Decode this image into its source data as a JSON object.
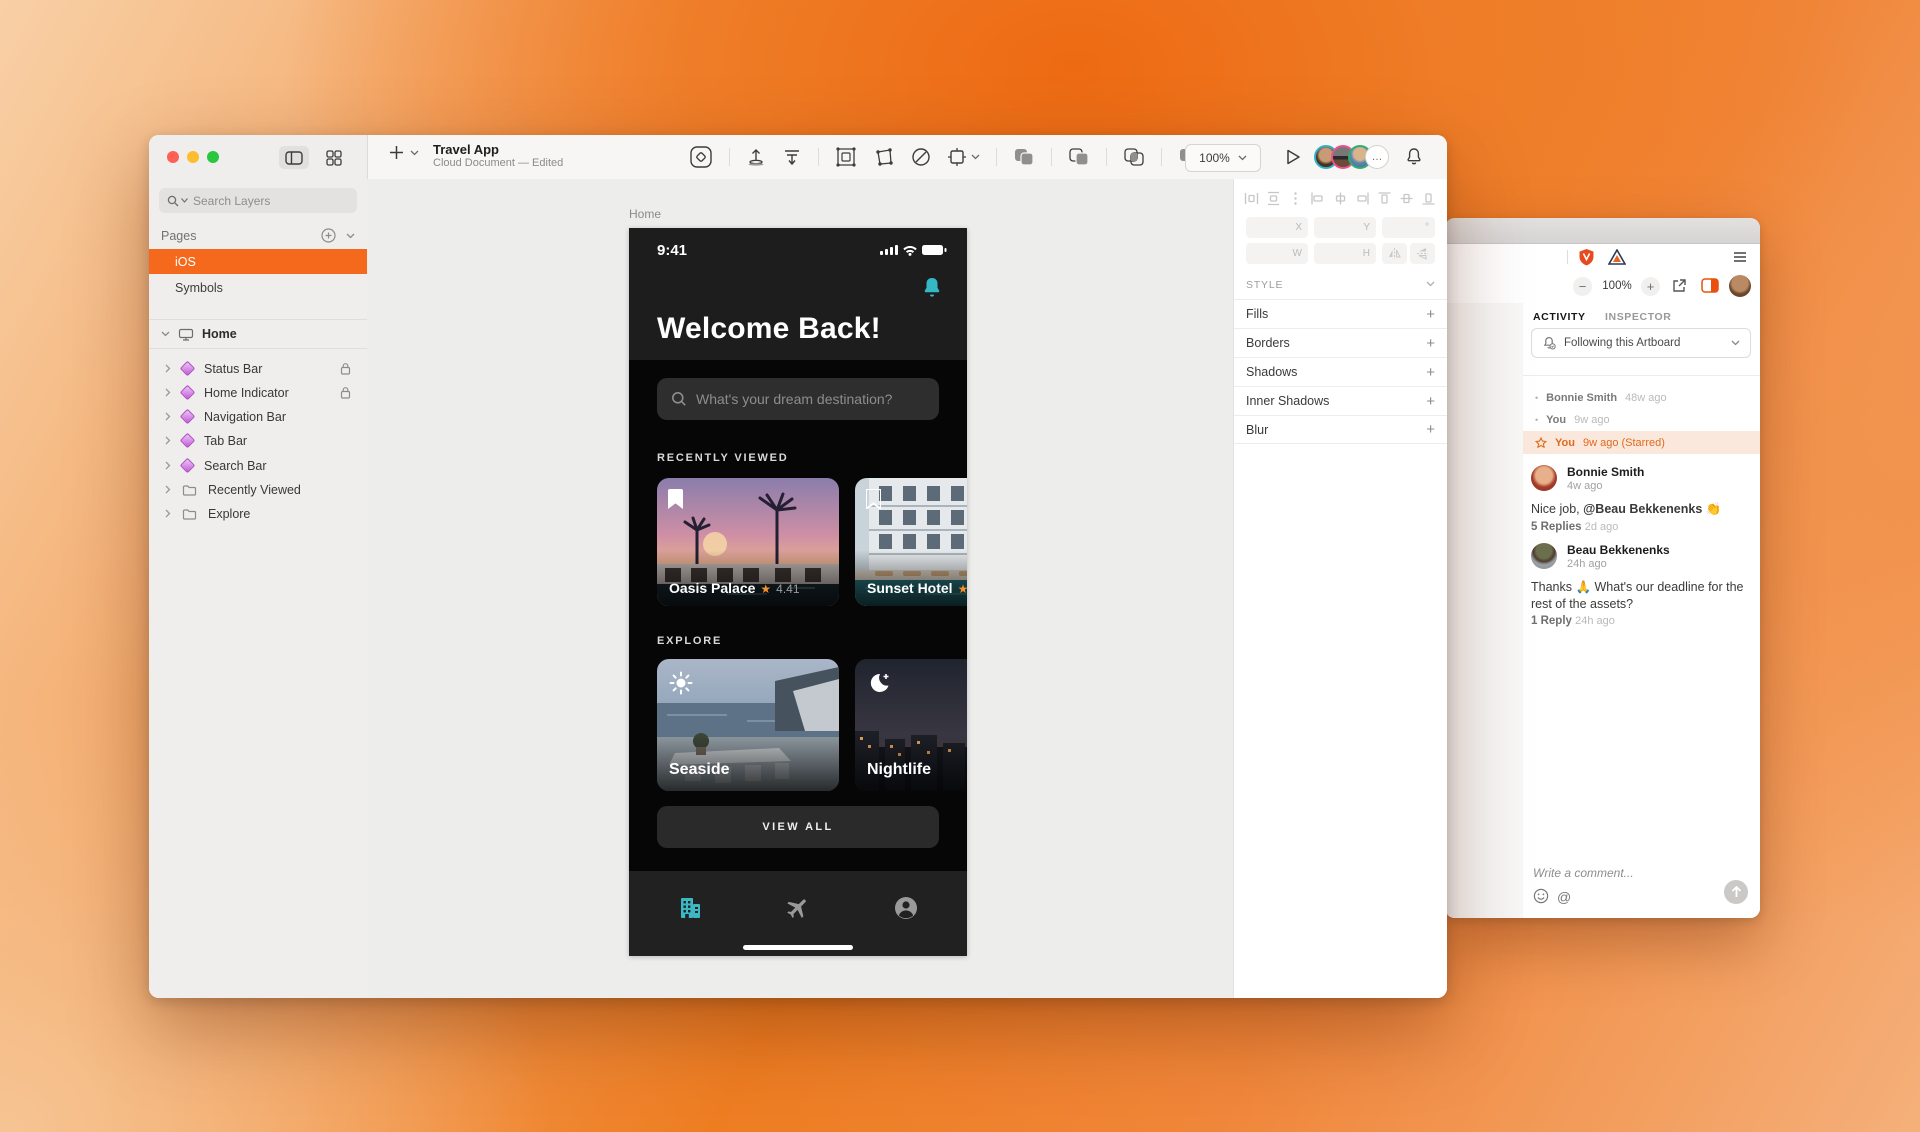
{
  "app": {
    "title": "Travel App",
    "subtitle": "Cloud Document — Edited",
    "zoom": "100%"
  },
  "sidebar": {
    "search_placeholder": "Search Layers",
    "pages_label": "Pages",
    "pages": [
      {
        "label": "iOS"
      },
      {
        "label": "Symbols"
      }
    ],
    "group_label": "Home",
    "layers": [
      {
        "label": "Status Bar"
      },
      {
        "label": "Home Indicator"
      },
      {
        "label": "Navigation Bar"
      },
      {
        "label": "Tab Bar"
      },
      {
        "label": "Search Bar"
      },
      {
        "label": "Recently Viewed"
      },
      {
        "label": "Explore"
      }
    ]
  },
  "canvas": {
    "artboard_label": "Home"
  },
  "phone": {
    "time": "9:41",
    "greeting": "Welcome Back!",
    "search_placeholder": "What's your dream destination?",
    "recently_viewed_label": "RECENTLY VIEWED",
    "cards": [
      {
        "name": "Oasis Palace",
        "rating": "4.41"
      },
      {
        "name": "Sunset Hotel"
      }
    ],
    "explore_label": "EXPLORE",
    "explore_cards": [
      {
        "name": "Seaside"
      },
      {
        "name": "Nightlife"
      }
    ],
    "view_all_label": "VIEW ALL"
  },
  "inspector": {
    "style_label": "STYLE",
    "fields": {
      "x": "X",
      "y": "Y",
      "w": "W",
      "h": "H",
      "rotation": "°"
    },
    "rows": [
      {
        "label": "Fills"
      },
      {
        "label": "Borders"
      },
      {
        "label": "Shadows"
      },
      {
        "label": "Inner Shadows"
      },
      {
        "label": "Blur"
      }
    ]
  },
  "browser": {
    "zoom": "100%",
    "tabs": [
      {
        "label": "ACTIVITY"
      },
      {
        "label": "INSPECTOR"
      }
    ],
    "following_label": "Following this Artboard",
    "activity": [
      {
        "name": "Bonnie Smith",
        "time": "48w ago"
      },
      {
        "name": "You",
        "time": "9w ago"
      },
      {
        "name": "You",
        "time": "9w ago (Starred)"
      }
    ],
    "comments": [
      {
        "name": "Bonnie Smith",
        "time": "4w ago",
        "body_text": "Nice job, ",
        "body_mention": "@Beau Bekkenenks 👏",
        "replies": "5 Replies",
        "replies_time": "2d ago"
      },
      {
        "name": "Beau Bekkenenks",
        "time": "24h ago",
        "body_text": "Thanks 🙏 What's our deadline for the rest of the assets?",
        "body_mention": "",
        "replies": "1 Reply",
        "replies_time": "24h ago"
      }
    ],
    "composer_placeholder": "Write a comment...",
    "at_glyph": "@"
  },
  "glyphs": {
    "star": "★",
    "plus": "+",
    "minus": "−",
    "ellipsis": "…",
    "bullet": "•"
  },
  "colors": {
    "accent_orange": "#f5691c",
    "teal": "#35b8c6",
    "star_orange": "#f2932e",
    "starred_bg": "#fbe8dc",
    "starred_text": "#e06a1e"
  }
}
